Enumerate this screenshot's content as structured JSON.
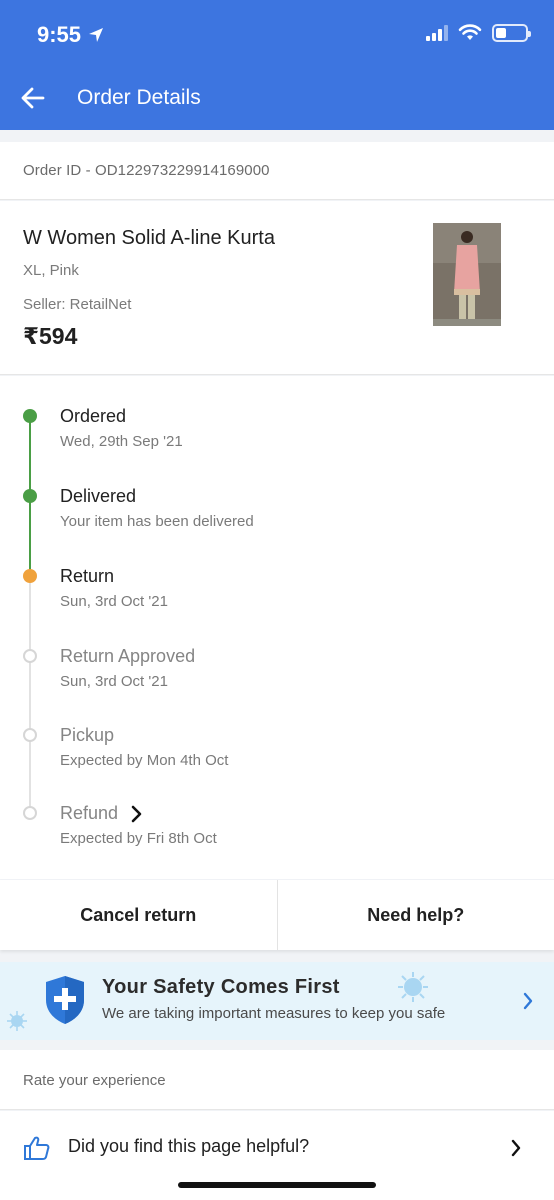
{
  "status_bar": {
    "time": "9:55",
    "battery_level": 0.35
  },
  "header": {
    "title": "Order Details",
    "back_icon": "back-arrow-icon"
  },
  "order": {
    "id_label": "Order ID - OD122973229914169000"
  },
  "product": {
    "name": "W Women Solid A-line Kurta",
    "variant": "XL, Pink",
    "seller": "Seller: RetailNet",
    "price": "₹594"
  },
  "timeline": [
    {
      "title": "Ordered",
      "subtitle": "Wed, 29th Sep '21",
      "state": "done"
    },
    {
      "title": "Delivered",
      "subtitle": "Your item has been delivered",
      "state": "done"
    },
    {
      "title": "Return",
      "subtitle": "Sun, 3rd Oct '21",
      "state": "current"
    },
    {
      "title": "Return Approved",
      "subtitle": "Sun, 3rd Oct '21",
      "state": "pending"
    },
    {
      "title": "Pickup",
      "subtitle": "Expected by Mon 4th Oct",
      "state": "pending"
    },
    {
      "title": "Refund",
      "subtitle": "Expected by Fri 8th Oct",
      "state": "pending"
    }
  ],
  "actions": {
    "cancel_return": "Cancel return",
    "need_help": "Need help?"
  },
  "safety_banner": {
    "title": "Your Safety Comes First",
    "subtitle": "We are taking important measures to keep you safe"
  },
  "rating": {
    "label": "Rate your experience",
    "question": "Did you find this page helpful?"
  },
  "colors": {
    "brand_blue": "#3d75e0",
    "done_green": "#4a9e45",
    "current_orange": "#f0a23c",
    "pending_grey": "#cfcfcf"
  }
}
